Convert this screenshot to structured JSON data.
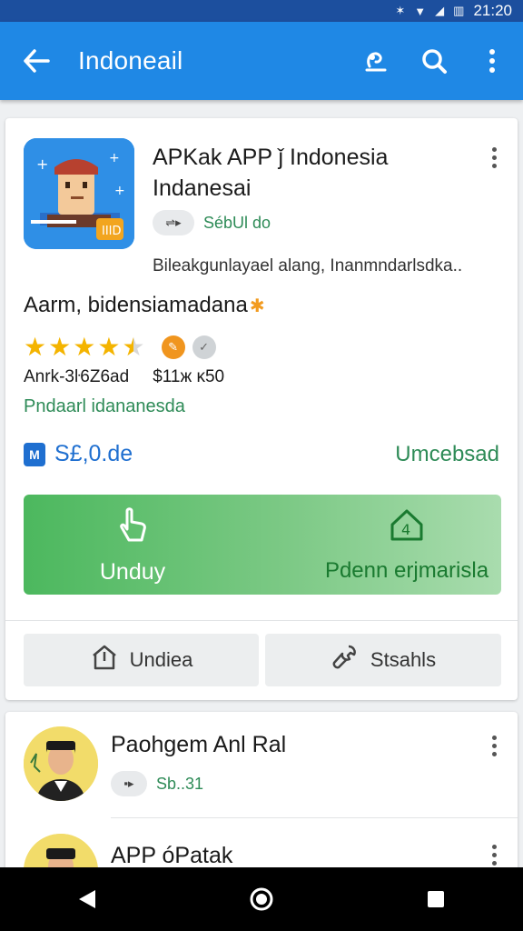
{
  "status_bar": {
    "time": "21:20"
  },
  "app_bar": {
    "title": "Indoneail"
  },
  "app_card": {
    "name_line1": "APKak APP ǰ Indonesia",
    "name_line2": "Indanesai",
    "chip_text": "SébUl do",
    "description": "Bileakgunlayael alang, Inanmndarlsdka..",
    "subtitle": "Aarm, bidensiamadana",
    "rating_meta": "Anrk-3ŀ6Z6ad",
    "price_meta": "$11ж ĸ50",
    "link": "Pndaarl idananesda",
    "price": "S£,0.de",
    "status": "Umcebsad",
    "install_label": "Unduy",
    "open_label": "Pdenn erjmarisla",
    "btn_left_label": "Undiea",
    "btn_right_label": "Stsahls"
  },
  "list": [
    {
      "name": "Paohgem Anl Ral",
      "chip_text": "Sb..31"
    },
    {
      "name": "APP óPatak"
    }
  ],
  "colors": {
    "app_bar": "#1f88e5",
    "status_bar": "#1c4f9e",
    "accent_green": "#2e8b57",
    "star": "#f4b400"
  },
  "icons": [
    "back-arrow-icon",
    "app-store-icon",
    "search-icon",
    "more-vert-icon",
    "hand-tap-icon",
    "home-app-icon",
    "share-icon",
    "wrench-icon",
    "nav-back-icon",
    "nav-home-icon",
    "nav-recents-icon"
  ]
}
